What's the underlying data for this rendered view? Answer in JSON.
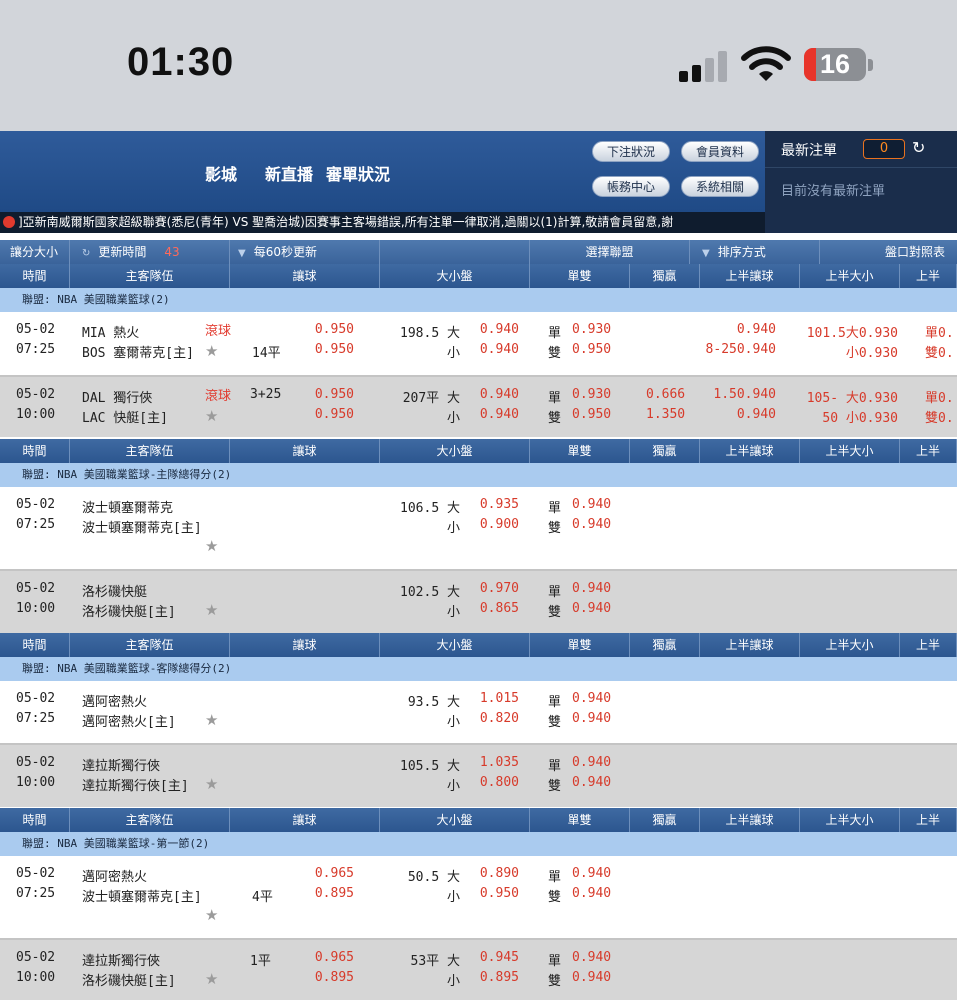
{
  "status_bar": {
    "time": "01:30",
    "battery": "16"
  },
  "header": {
    "nav": [
      "影城",
      "新直播",
      "審單狀況"
    ],
    "buttons": {
      "bet_status": "下注狀況",
      "member_info": "會員資料",
      "account_center": "帳務中心",
      "system": "系統相關"
    }
  },
  "latest_bets": {
    "title": "最新注單",
    "count": "0",
    "empty_text": "目前沒有最新注單"
  },
  "marquee": "]亞新南威爾斯國家超級聯賽(悉尼(青年) VS 聖喬治城)因賽事主客場錯誤,所有注單一律取消,過關以(1)計算,敬請會員留意,謝",
  "toolbar": {
    "odds_type": "讓分大小",
    "update_time": "更新時間",
    "update_count": "43",
    "auto_update": "每60秒更新",
    "select_league": "選擇聯盟",
    "sort": "排序方式",
    "odds_table": "盤口對照表"
  },
  "columns": [
    "時間",
    "主客隊伍",
    "讓球",
    "大小盤",
    "單雙",
    "獨贏",
    "上半讓球",
    "上半大小",
    "上半"
  ],
  "sections": [
    {
      "league": "聯盟: NBA 美國職業籃球(2)",
      "games": [
        {
          "date": "05-02",
          "time": "07:25",
          "team1": "MIA 熱火",
          "team2": "BOS 塞爾蒂克[主]",
          "live": "滾球",
          "hdp1": "",
          "hdp2": "14平",
          "hdp_o1": "0.950",
          "hdp_o2": "0.950",
          "ou_l1": "198.5 大",
          "ou_l2": "小",
          "ou_o1": "0.940",
          "ou_o2": "0.940",
          "oe_o1": "0.930",
          "oe_o2": "0.950",
          "ml1": "",
          "ml2": "",
          "h1hdp1": "0.940",
          "h1hdp2": "8-250.940",
          "h1ou1": "101.5大0.930",
          "h1ou2": "小0.930",
          "h1x1": "單0.",
          "h1x2": "雙0."
        },
        {
          "date": "05-02",
          "time": "10:00",
          "team1": "DAL 獨行俠",
          "team2": "LAC 快艇[主]",
          "live": "滾球",
          "hdp1": "3+25",
          "hdp2": "",
          "hdp_o1": "0.950",
          "hdp_o2": "0.950",
          "ou_l1": "207平 大",
          "ou_l2": "小",
          "ou_o1": "0.940",
          "ou_o2": "0.940",
          "oe_o1": "0.930",
          "oe_o2": "0.950",
          "ml1": "0.666",
          "ml2": "1.350",
          "h1hdp1": "1.50.940",
          "h1hdp2": "0.940",
          "h1ou1": "105- 大0.930",
          "h1ou2": "50 小0.930",
          "h1x1": "單0.",
          "h1x2": "雙0."
        }
      ]
    },
    {
      "league": "聯盟: NBA 美國職業籃球-主隊總得分(2)",
      "games": [
        {
          "date": "05-02",
          "time": "07:25",
          "team1": "波士頓塞爾蒂克",
          "team2": "波士頓塞爾蒂克[主]",
          "live": "",
          "hdp1": "",
          "hdp2": "",
          "hdp_o1": "",
          "hdp_o2": "",
          "ou_l1": "106.5 大",
          "ou_l2": "小",
          "ou_o1": "0.935",
          "ou_o2": "0.900",
          "oe_o1": "0.940",
          "oe_o2": "0.940",
          "ml1": "",
          "ml2": "",
          "h1hdp1": "",
          "h1hdp2": "",
          "h1ou1": "",
          "h1ou2": "",
          "h1x1": "",
          "h1x2": ""
        },
        {
          "date": "05-02",
          "time": "10:00",
          "team1": "洛杉磯快艇",
          "team2": "洛杉磯快艇[主]",
          "live": "",
          "hdp1": "",
          "hdp2": "",
          "hdp_o1": "",
          "hdp_o2": "",
          "ou_l1": "102.5 大",
          "ou_l2": "小",
          "ou_o1": "0.970",
          "ou_o2": "0.865",
          "oe_o1": "0.940",
          "oe_o2": "0.940",
          "ml1": "",
          "ml2": "",
          "h1hdp1": "",
          "h1hdp2": "",
          "h1ou1": "",
          "h1ou2": "",
          "h1x1": "",
          "h1x2": ""
        }
      ]
    },
    {
      "league": "聯盟: NBA 美國職業籃球-客隊總得分(2)",
      "games": [
        {
          "date": "05-02",
          "time": "07:25",
          "team1": "邁阿密熱火",
          "team2": "邁阿密熱火[主]",
          "live": "",
          "hdp1": "",
          "hdp2": "",
          "hdp_o1": "",
          "hdp_o2": "",
          "ou_l1": "93.5 大",
          "ou_l2": "小",
          "ou_o1": "1.015",
          "ou_o2": "0.820",
          "oe_o1": "0.940",
          "oe_o2": "0.940",
          "ml1": "",
          "ml2": "",
          "h1hdp1": "",
          "h1hdp2": "",
          "h1ou1": "",
          "h1ou2": "",
          "h1x1": "",
          "h1x2": ""
        },
        {
          "date": "05-02",
          "time": "10:00",
          "team1": "達拉斯獨行俠",
          "team2": "達拉斯獨行俠[主]",
          "live": "",
          "hdp1": "",
          "hdp2": "",
          "hdp_o1": "",
          "hdp_o2": "",
          "ou_l1": "105.5 大",
          "ou_l2": "小",
          "ou_o1": "1.035",
          "ou_o2": "0.800",
          "oe_o1": "0.940",
          "oe_o2": "0.940",
          "ml1": "",
          "ml2": "",
          "h1hdp1": "",
          "h1hdp2": "",
          "h1ou1": "",
          "h1ou2": "",
          "h1x1": "",
          "h1x2": ""
        }
      ]
    },
    {
      "league": "聯盟: NBA 美國職業籃球-第一節(2)",
      "games": [
        {
          "date": "05-02",
          "time": "07:25",
          "team1": "邁阿密熱火",
          "team2": "波士頓塞爾蒂克[主]",
          "live": "",
          "hdp1": "",
          "hdp2": "4平",
          "hdp_o1": "0.965",
          "hdp_o2": "0.895",
          "ou_l1": "50.5 大",
          "ou_l2": "小",
          "ou_o1": "0.890",
          "ou_o2": "0.950",
          "oe_o1": "0.940",
          "oe_o2": "0.940",
          "ml1": "",
          "ml2": "",
          "h1hdp1": "",
          "h1hdp2": "",
          "h1ou1": "",
          "h1ou2": "",
          "h1x1": "",
          "h1x2": ""
        },
        {
          "date": "05-02",
          "time": "10:00",
          "team1": "達拉斯獨行俠",
          "team2": "洛杉磯快艇[主]",
          "live": "",
          "hdp1": "1平",
          "hdp2": "",
          "hdp_o1": "0.965",
          "hdp_o2": "0.895",
          "ou_l1": "53平 大",
          "ou_l2": "小",
          "ou_o1": "0.945",
          "ou_o2": "0.895",
          "oe_o1": "0.940",
          "oe_o2": "0.940",
          "ml1": "",
          "ml2": "",
          "h1hdp1": "",
          "h1hdp2": "",
          "h1ou1": "",
          "h1ou2": "",
          "h1x1": "",
          "h1x2": ""
        }
      ]
    }
  ],
  "labels": {
    "odd": "單",
    "even": "雙"
  },
  "colors": {
    "header_blue": "#2f5b9a",
    "league_bar": "#aacbef",
    "odds_red": "#d73a2a",
    "live_red": "#e23a2f"
  }
}
